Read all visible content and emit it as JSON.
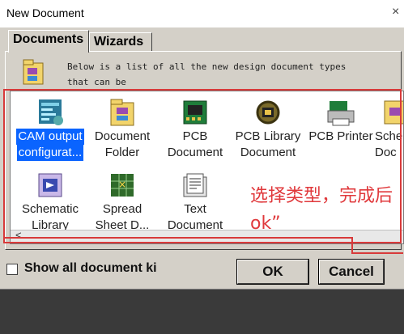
{
  "window": {
    "title": "New Document",
    "close_glyph": "×"
  },
  "tabs": [
    {
      "label": "Documents",
      "active": true
    },
    {
      "label": "Wizards",
      "active": false
    }
  ],
  "description": {
    "line1": "Below is a list of all the new design document types",
    "line2": "that can be"
  },
  "items": [
    {
      "name": "cam-output-icon",
      "line1": "CAM output",
      "line2": "configurat...",
      "selected": true
    },
    {
      "name": "document-folder-icon",
      "line1": "Document",
      "line2": "Folder",
      "selected": false
    },
    {
      "name": "pcb-document-icon",
      "line1": "PCB",
      "line2": "Document",
      "selected": false
    },
    {
      "name": "pcb-library-icon",
      "line1": "PCB Library",
      "line2": "Document",
      "selected": false
    },
    {
      "name": "pcb-printer-icon",
      "line1": "PCB Printer",
      "line2": "",
      "selected": false
    },
    {
      "name": "schematic-document-icon",
      "line1": "Sche",
      "line2": "Doc",
      "selected": false
    },
    {
      "name": "schematic-library-icon",
      "line1": "Schematic",
      "line2": "Library",
      "selected": false
    },
    {
      "name": "spreadsheet-icon",
      "line1": "Spread",
      "line2": "Sheet D...",
      "selected": false
    },
    {
      "name": "text-document-icon",
      "line1": "Text",
      "line2": "Document",
      "selected": false
    }
  ],
  "annotation": {
    "line1": "选择类型，完成后",
    "line2": "ok”",
    "color": "#e0393c"
  },
  "footer": {
    "checkbox_label": "Show all document ki",
    "ok_label": "OK",
    "cancel_label": "Cancel"
  },
  "colors": {
    "selection": "#0a64ff",
    "dialog_bg": "#d4d0c8"
  }
}
